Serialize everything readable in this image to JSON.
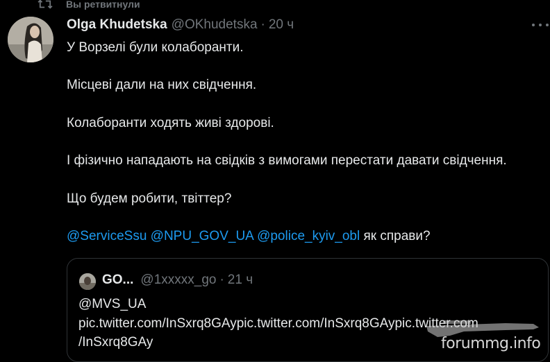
{
  "retweet": {
    "label": "Вы ретвитнули",
    "icon": "retweet-icon"
  },
  "tweet": {
    "author_name": "Olga Khudetska",
    "author_handle": "@OKhudetska",
    "separator": "·",
    "time": "20 ч",
    "paragraphs": [
      "У Ворзелі були колаборанти.",
      "Місцеві дали на них свідчення.",
      "Колаборанти ходять живі здорові.",
      "І фізично нападають на свідків з вимогами перестати давати свідчення.",
      "Що будем робити, твіттер?"
    ],
    "mentions": [
      "@ServiceSsu",
      "@NPU_GOV_UA",
      "@police_kyiv_obl"
    ],
    "mentions_tail": "як справи?"
  },
  "quote": {
    "author_name": "GO...",
    "author_handle": "@1xxxxx_go",
    "separator": "·",
    "time": "21 ч",
    "lines": [
      "@MVS_UA",
      "pic.twitter.com/InSxrq8GAypic.twitter.com/InSxrq8GAypic.twitter.com",
      "/InSxrq8GAy"
    ]
  },
  "watermark": {
    "text": "forummg.info"
  },
  "colors": {
    "background": "#000000",
    "text": "#e7e9ea",
    "muted": "#71767b",
    "link": "#1d9bf0",
    "border": "#2f3336"
  }
}
